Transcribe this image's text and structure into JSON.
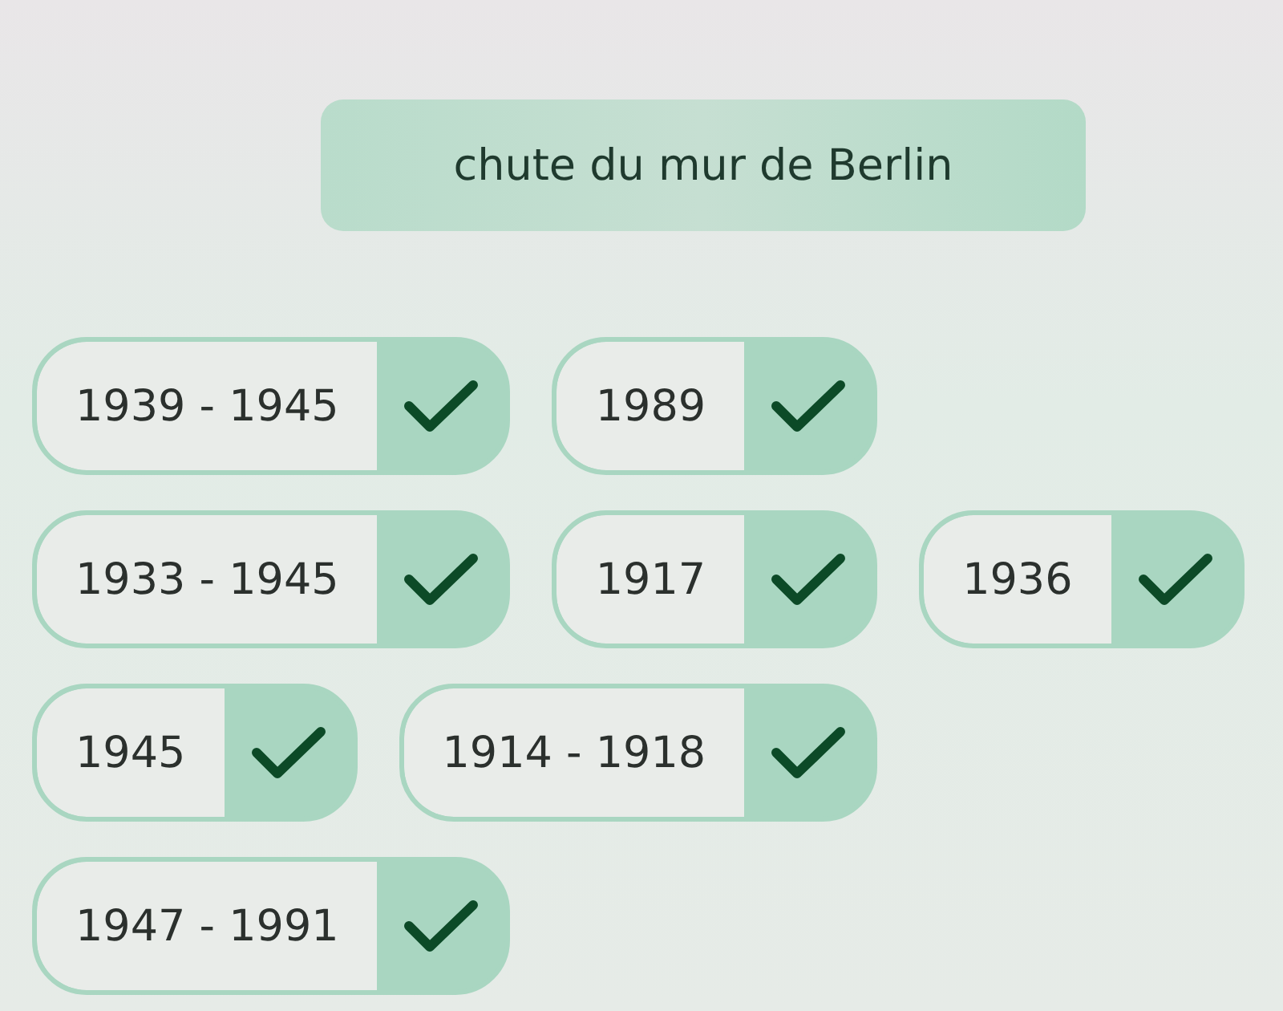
{
  "prompt": {
    "text": "chute du mur de Berlin"
  },
  "answer_rows": [
    [
      {
        "label": "1939 - 1945"
      },
      {
        "label": "1989"
      }
    ],
    [
      {
        "label": "1933 - 1945"
      },
      {
        "label": "1917"
      },
      {
        "label": "1936"
      }
    ],
    [
      {
        "label": "1945"
      },
      {
        "label": "1914 - 1918"
      }
    ],
    [
      {
        "label": "1947 - 1991"
      }
    ]
  ]
}
